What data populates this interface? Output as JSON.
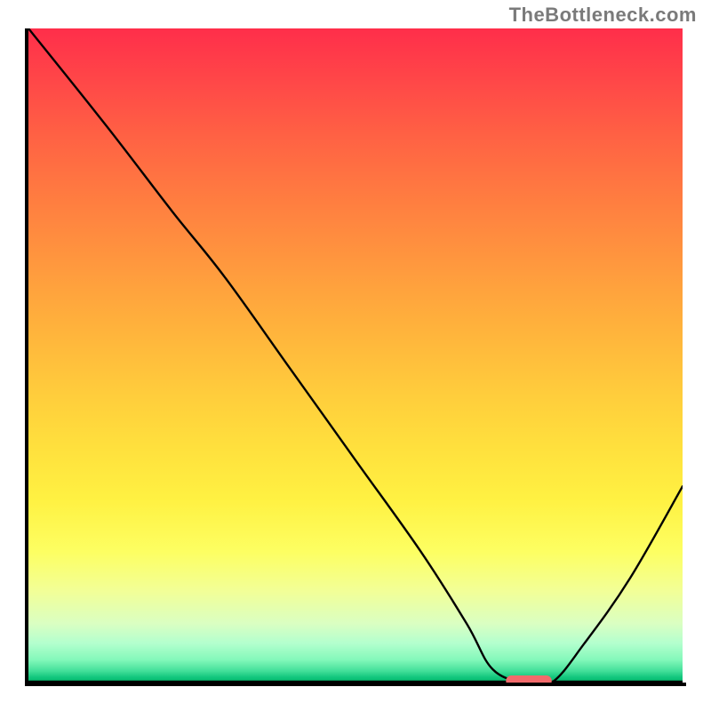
{
  "watermark": "TheBottleneck.com",
  "chart_data": {
    "type": "line",
    "title": "",
    "xlabel": "",
    "ylabel": "",
    "xlim": [
      0,
      100
    ],
    "ylim": [
      0,
      100
    ],
    "background": "vertical-gradient-red-to-green",
    "gradient_stops": [
      {
        "pct": 0,
        "color": "#ff2e4a"
      },
      {
        "pct": 50,
        "color": "#ffcd3c"
      },
      {
        "pct": 85,
        "color": "#fdff62"
      },
      {
        "pct": 100,
        "color": "#00b86a"
      }
    ],
    "series": [
      {
        "name": "bottleneck-curve",
        "x": [
          0,
          12,
          22,
          30,
          40,
          50,
          60,
          67,
          71,
          76,
          80,
          85,
          92,
          100
        ],
        "y": [
          100,
          85,
          72,
          62,
          48,
          34,
          20,
          9,
          2,
          0,
          0,
          6,
          16,
          30
        ]
      }
    ],
    "marker": {
      "name": "optimal-range",
      "x_start": 73,
      "x_end": 80,
      "y": 0,
      "color": "#f26a6b",
      "shape": "rounded"
    }
  }
}
